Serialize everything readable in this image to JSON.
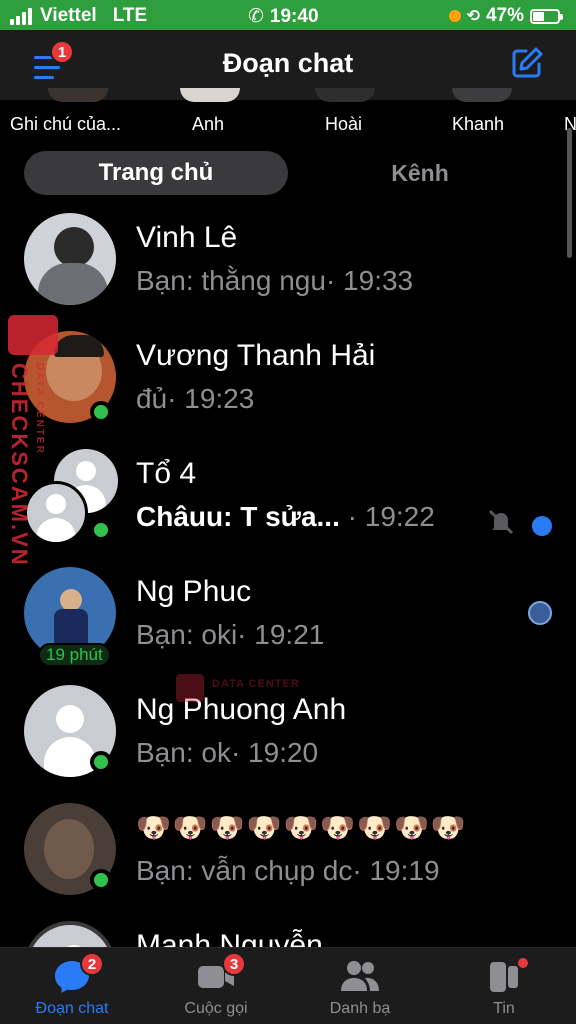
{
  "status_bar": {
    "carrier": "Viettel",
    "network": "LTE",
    "time": "19:40",
    "battery_text": "47%",
    "battery_level": 0.47,
    "background": "#2f9e3c"
  },
  "header": {
    "title": "Đoạn chat",
    "menu_badge": "1",
    "accent": "#2a7cf6"
  },
  "notes": [
    {
      "label": "Ghi chú của..."
    },
    {
      "label": "Anh"
    },
    {
      "label": "Hoài"
    },
    {
      "label": "Khanh"
    },
    {
      "label": "N"
    }
  ],
  "tabs": {
    "active": "Trang chủ",
    "inactive": "Kênh"
  },
  "chats": [
    {
      "name": "Vinh Lê",
      "preview": "Bạn: thằng ngu",
      "time": "· 19:33",
      "avatar_color": "#8a8f96",
      "online": false
    },
    {
      "name": "Vương Thanh Hải",
      "preview": "đủ",
      "time": "· 19:23",
      "avatar_color": "#b5562e",
      "online": true
    },
    {
      "name": "Tổ 4",
      "preview": "Châuu: T sửa...",
      "time": " · 19:22",
      "unread": true,
      "muted": true,
      "online": true
    },
    {
      "name": "Ng Phuc",
      "preview": "Bạn: oki",
      "time": "· 19:21",
      "avatar_color": "#3a6fb0",
      "active_ago": "19 phút",
      "seen": true
    },
    {
      "name": "Ng Phuong Anh",
      "preview": "Bạn: ok",
      "time": "· 19:20",
      "online": true
    },
    {
      "name": "🐶🐶🐶🐶🐶🐶🐶🐶🐶",
      "preview": "Bạn: vẫn chụp dc",
      "time": "· 19:19",
      "avatar_color": "#4a3f38",
      "online": true
    },
    {
      "name": "Mạnh Nguyễn",
      "preview": "",
      "time": ""
    }
  ],
  "bottom_nav": [
    {
      "label": "Đoạn chat",
      "badge": "2",
      "active": true
    },
    {
      "label": "Cuộc gọi",
      "badge": "3",
      "active": false
    },
    {
      "label": "Danh bạ",
      "badge": "",
      "active": false
    },
    {
      "label": "Tin",
      "badge": "",
      "active": false
    }
  ],
  "watermark": {
    "side_text": "CHECKSCAM.VN",
    "side_sub": "DATA CENTER",
    "mid_text": "DATA CENTER"
  }
}
